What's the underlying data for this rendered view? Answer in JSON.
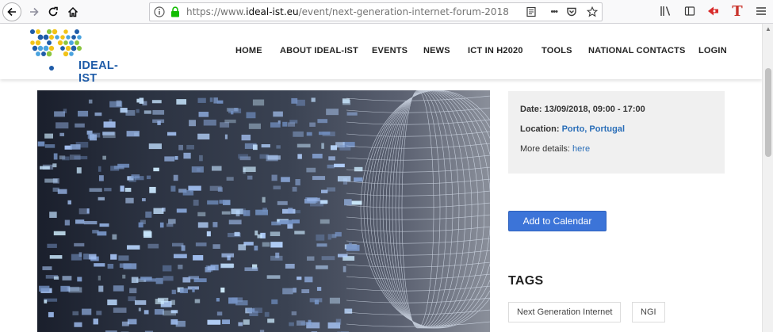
{
  "browser": {
    "url_prefix": "https://www.",
    "url_domain": "ideal-ist.eu",
    "url_path": "/event/next-generation-internet-forum-2018",
    "menu_dots": "•••"
  },
  "site": {
    "logo_text": "IDEAL-IST",
    "nav": [
      "HOME",
      "ABOUT IDEAL-IST",
      "EVENTS",
      "NEWS",
      "ICT IN H2020",
      "TOOLS",
      "NATIONAL CONTACTS",
      "LOGIN"
    ]
  },
  "event": {
    "date_label": "Date:",
    "date_value": "13/09/2018, 09:00 - 17:00",
    "location_label": "Location:",
    "location_value": "Porto, Portugal",
    "details_label": "More details:",
    "details_link": "here",
    "calendar_button": "Add to Calendar"
  },
  "tags": {
    "title": "TAGS",
    "items": [
      "Next Generation Internet",
      "NGI"
    ]
  },
  "colors": {
    "brand_blue": "#1f5ca8",
    "link_blue": "#2a6eb8",
    "button_blue": "#3c74d8",
    "logo_green": "#8bc53f",
    "logo_yellow": "#f2c318"
  }
}
